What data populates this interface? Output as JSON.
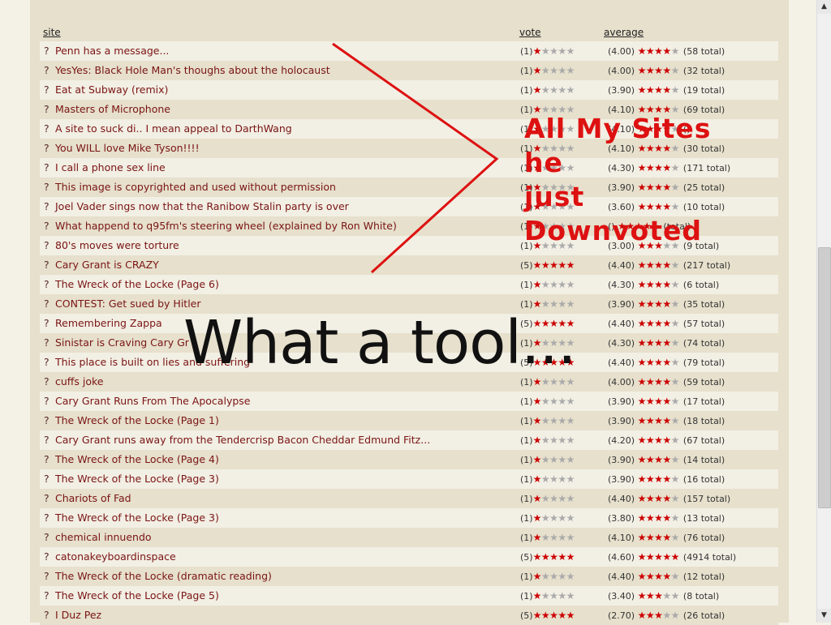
{
  "headers": {
    "site": "site",
    "vote": "vote",
    "average": "average"
  },
  "rows": [
    {
      "title": "Penn has a message...",
      "vote": 1,
      "avg": "4.00",
      "avg_value": 4.0,
      "total": "58 total"
    },
    {
      "title": "YesYes: Black Hole Man's thoughs about the holocaust",
      "vote": 1,
      "avg": "4.00",
      "avg_value": 4.0,
      "total": "32 total"
    },
    {
      "title": "Eat at Subway (remix)",
      "vote": 1,
      "avg": "3.90",
      "avg_value": 3.9,
      "total": "19 total"
    },
    {
      "title": "Masters of Microphone",
      "vote": 1,
      "avg": "4.10",
      "avg_value": 4.1,
      "total": "69 total"
    },
    {
      "title": "A site to suck di.. I mean appeal to DarthWang",
      "vote": 1,
      "avg": "4.10",
      "avg_value": 4.1,
      "total": ""
    },
    {
      "title": "You WILL love Mike Tyson!!!!",
      "vote": 1,
      "avg": "4.10",
      "avg_value": 4.1,
      "total": "30 total"
    },
    {
      "title": "I call a phone sex line",
      "vote": 1,
      "avg": "4.30",
      "avg_value": 4.3,
      "total": "171 total"
    },
    {
      "title": "This image is copyrighted and used without permission",
      "vote": 1,
      "avg": "3.90",
      "avg_value": 3.9,
      "total": "25 total"
    },
    {
      "title": "Joel Vader sings now that the Ranibow Stalin party is over",
      "vote": 1,
      "avg": "3.60",
      "avg_value": 3.6,
      "total": "10 total"
    },
    {
      "title": "What happend to q95fm's steering wheel (explained by Ron White)",
      "vote": 1,
      "avg": "",
      "avg_value": 3.5,
      "total": "total"
    },
    {
      "title": "80's moves were torture",
      "vote": 1,
      "avg": "3.00",
      "avg_value": 3.0,
      "total": "9 total"
    },
    {
      "title": "Cary Grant is CRAZY",
      "vote": 5,
      "avg": "4.40",
      "avg_value": 4.4,
      "total": "217 total"
    },
    {
      "title": "The Wreck of the Locke (Page 6)",
      "vote": 1,
      "avg": "4.30",
      "avg_value": 4.3,
      "total": "6 total"
    },
    {
      "title": "CONTEST: Get sued by Hitler",
      "vote": 1,
      "avg": "3.90",
      "avg_value": 3.9,
      "total": "35 total"
    },
    {
      "title": "Remembering Zappa",
      "vote": 5,
      "avg": "4.40",
      "avg_value": 4.4,
      "total": "57 total"
    },
    {
      "title": "Sinistar is Craving Cary Gr",
      "vote": 1,
      "avg": "4.30",
      "avg_value": 4.3,
      "total": "74 total"
    },
    {
      "title": "This place is built on lies and suffering",
      "vote": 5,
      "avg": "4.40",
      "avg_value": 4.4,
      "total": "79 total"
    },
    {
      "title": "cuffs joke",
      "vote": 1,
      "avg": "4.00",
      "avg_value": 4.0,
      "total": "59 total"
    },
    {
      "title": "Cary Grant Runs From The Apocalypse",
      "vote": 1,
      "avg": "3.90",
      "avg_value": 3.9,
      "total": "17 total"
    },
    {
      "title": "The Wreck of the Locke (Page 1)",
      "vote": 1,
      "avg": "3.90",
      "avg_value": 3.9,
      "total": "18 total"
    },
    {
      "title": "Cary Grant runs away from the Tendercrisp Bacon Cheddar Edmund Fitz...",
      "vote": 1,
      "avg": "4.20",
      "avg_value": 4.2,
      "total": "67 total"
    },
    {
      "title": "The Wreck of the Locke (Page 4)",
      "vote": 1,
      "avg": "3.90",
      "avg_value": 3.9,
      "total": "14 total"
    },
    {
      "title": "The Wreck of the Locke (Page 3)",
      "vote": 1,
      "avg": "3.90",
      "avg_value": 3.9,
      "total": "16 total"
    },
    {
      "title": "Chariots of Fad",
      "vote": 1,
      "avg": "4.40",
      "avg_value": 4.4,
      "total": "157 total"
    },
    {
      "title": "The Wreck of the Locke (Page 3)",
      "vote": 1,
      "avg": "3.80",
      "avg_value": 3.8,
      "total": "13 total"
    },
    {
      "title": "chemical innuendo",
      "vote": 1,
      "avg": "4.10",
      "avg_value": 4.1,
      "total": "76 total"
    },
    {
      "title": "catonakeyboardinspace",
      "vote": 5,
      "avg": "4.60",
      "avg_value": 4.6,
      "total": "4914 total"
    },
    {
      "title": "The Wreck of the Locke (dramatic reading)",
      "vote": 1,
      "avg": "4.40",
      "avg_value": 4.4,
      "total": "12 total"
    },
    {
      "title": "The Wreck of the Locke (Page 5)",
      "vote": 1,
      "avg": "3.40",
      "avg_value": 3.4,
      "total": "8 total"
    },
    {
      "title": "I Duz Pez",
      "vote": 5,
      "avg": "2.70",
      "avg_value": 2.7,
      "total": "26 total"
    }
  ],
  "row_marker": "?",
  "overlay": {
    "note_lines": [
      "All My Sites",
      "he",
      "just",
      "Downvoted"
    ],
    "caption": "What a tool...",
    "note_color": "#dd1111",
    "arrow_color": "#dd1111"
  },
  "icons": {
    "star": "star-icon",
    "scroll_up": "scroll-up-arrow-icon",
    "scroll_down": "scroll-down-arrow-icon"
  },
  "colors": {
    "link": "#7a1414",
    "star_on": "#cc0000",
    "star_off": "#aaaaaa"
  }
}
